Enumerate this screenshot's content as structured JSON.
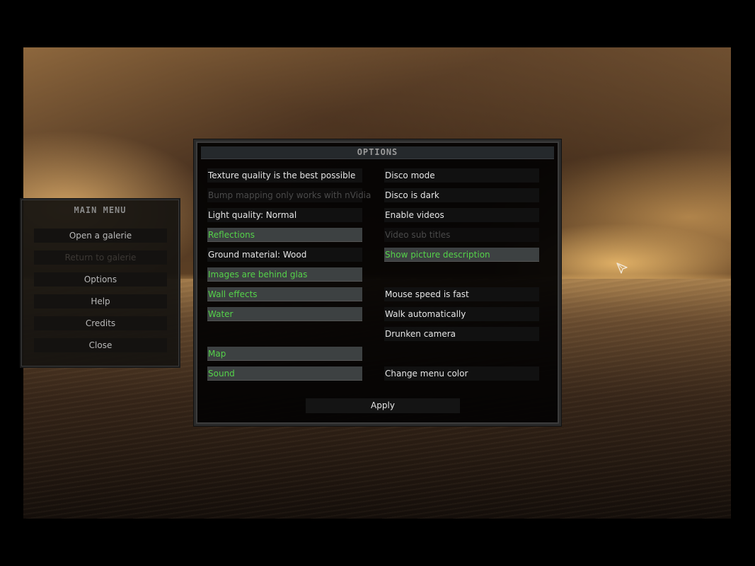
{
  "colors": {
    "enabled_text": "#55d24a",
    "normal_text": "#e6e6e6",
    "disabled_text": "#4a4a4a",
    "enabled_row_bg": "#3d4142",
    "normal_row_bg": "#111111"
  },
  "main_menu": {
    "title": "MAIN MENU",
    "items": [
      {
        "label": "Open a galerie",
        "state": "normal"
      },
      {
        "label": "Return to galerie",
        "state": "disabled"
      },
      {
        "label": "Options",
        "state": "normal"
      },
      {
        "label": "Help",
        "state": "normal"
      },
      {
        "label": "Credits",
        "state": "normal"
      },
      {
        "label": "Close",
        "state": "normal"
      }
    ]
  },
  "options": {
    "title": "OPTIONS",
    "left_column": [
      {
        "label": "Texture quality is the best possible",
        "state": "normal"
      },
      {
        "label": "Bump mapping only works with nVidia",
        "state": "disabled"
      },
      {
        "label": "Light quality: Normal",
        "state": "normal"
      },
      {
        "label": "Reflections",
        "state": "on"
      },
      {
        "label": "Ground material: Wood",
        "state": "normal"
      },
      {
        "label": "Images are behind glas",
        "state": "on"
      },
      {
        "label": "Wall effects",
        "state": "on"
      },
      {
        "label": "Water",
        "state": "on"
      },
      null,
      {
        "label": "Map",
        "state": "on"
      },
      {
        "label": "Sound",
        "state": "on"
      }
    ],
    "right_column": [
      {
        "label": "Disco mode",
        "state": "normal"
      },
      {
        "label": "Disco is dark",
        "state": "normal"
      },
      {
        "label": "Enable videos",
        "state": "normal"
      },
      {
        "label": "Video sub titles",
        "state": "disabled"
      },
      {
        "label": "Show picture description",
        "state": "on"
      },
      null,
      {
        "label": "Mouse speed is fast",
        "state": "normal"
      },
      {
        "label": "Walk automatically",
        "state": "normal"
      },
      {
        "label": "Drunken camera",
        "state": "normal"
      },
      null,
      {
        "label": "Change menu color",
        "state": "normal"
      }
    ],
    "apply_label": "Apply"
  },
  "cursor": {
    "icon": "arrow-cursor-icon"
  }
}
